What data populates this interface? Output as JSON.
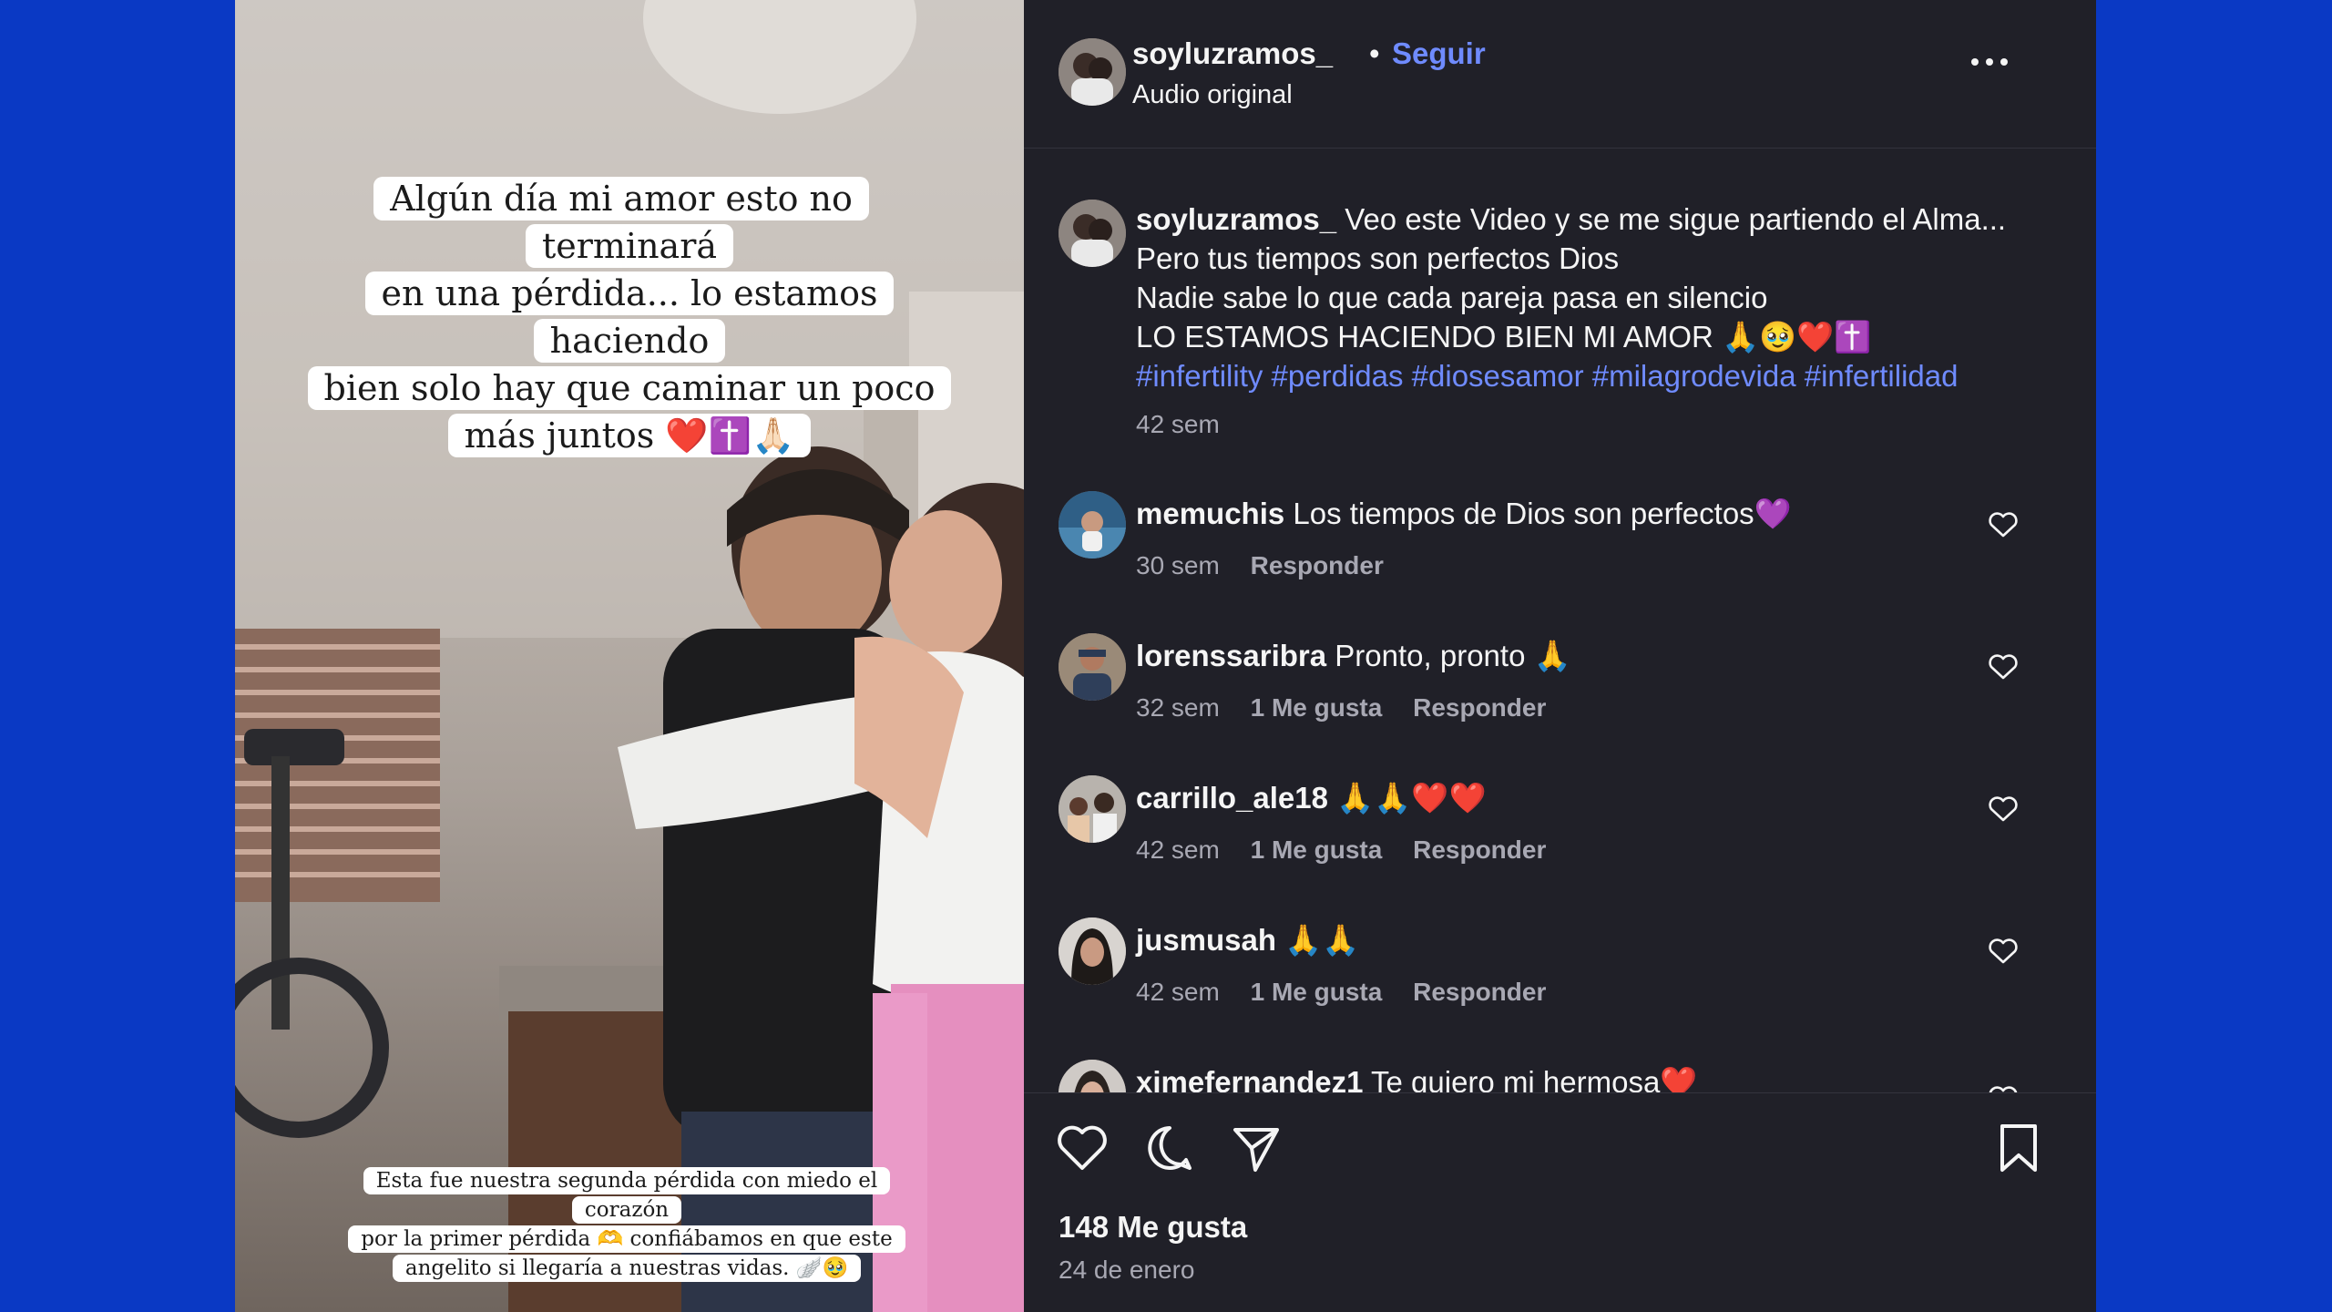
{
  "colors": {
    "page_bg": "#0a39c4",
    "panel_bg": "#202028",
    "link": "#6f8bff",
    "muted": "#a8a8b3"
  },
  "media": {
    "top_text": [
      "Algún día mi amor esto no terminará",
      "en una pérdida... lo estamos haciendo",
      "bien solo hay que caminar un poco",
      "más juntos ❤️✝️🙏🏻"
    ],
    "bottom_text": [
      "Esta fue nuestra segunda pérdida con miedo el corazón",
      "por la primer pérdida 🫶 confiábamos en que este",
      "angelito si llegaría a nuestras vidas. 🪽🥹"
    ]
  },
  "header": {
    "username": "soyluzramos_",
    "dot": "•",
    "follow": "Seguir",
    "subtitle": "Audio original",
    "more_icon": "more-horizontal-icon"
  },
  "caption": {
    "username": "soyluzramos_",
    "lines": [
      "Veo este Video y se me sigue partiendo el Alma...",
      "Pero tus tiempos son perfectos Dios",
      "Nadie sabe lo que cada pareja pasa en silencio",
      "LO ESTAMOS HACIENDO BIEN MI AMOR 🙏🥹❤️✝️"
    ],
    "hashtags": "#infertility #perdidas #diosesamor #milagrodevida #infertilidad",
    "time": "42 sem"
  },
  "comments": [
    {
      "username": "memuchis",
      "text": "Los tiempos de Dios son perfectos💜",
      "time": "30 sem",
      "likes": "",
      "reply": "Responder"
    },
    {
      "username": "lorenssaribra",
      "text": "Pronto, pronto 🙏",
      "time": "32 sem",
      "likes": "1 Me gusta",
      "reply": "Responder"
    },
    {
      "username": "carrillo_ale18",
      "text": "🙏🙏❤️❤️",
      "time": "42 sem",
      "likes": "1 Me gusta",
      "reply": "Responder"
    },
    {
      "username": "jusmusah",
      "text": "🙏🙏",
      "time": "42 sem",
      "likes": "1 Me gusta",
      "reply": "Responder"
    },
    {
      "username": "ximefernandez1",
      "text": "Te quiero mi hermosa❤️",
      "time": "",
      "likes": "",
      "reply": ""
    }
  ],
  "actions": {
    "like_icon": "heart-icon",
    "comment_icon": "comment-icon",
    "share_icon": "share-icon",
    "save_icon": "bookmark-icon",
    "likes": "148 Me gusta",
    "date": "24 de enero"
  }
}
